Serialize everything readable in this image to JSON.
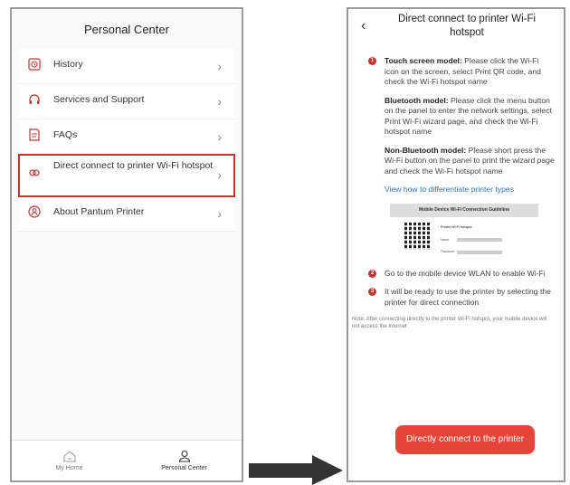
{
  "left": {
    "title": "Personal Center",
    "items": [
      {
        "label": "History",
        "icon": "history-icon"
      },
      {
        "label": "Services and Support",
        "icon": "headset-icon"
      },
      {
        "label": "FAQs",
        "icon": "faq-icon"
      },
      {
        "label": "Direct connect to printer Wi-Fi hotspot",
        "icon": "link-icon"
      },
      {
        "label": "About Pantum Printer",
        "icon": "info-icon"
      }
    ],
    "tabs": [
      "My Home",
      "Personal Center"
    ]
  },
  "right": {
    "title": "Direct connect to printer Wi-Fi hotspot",
    "step1_touch_label": "Touch screen model:",
    "step1_touch_text": " Please click the Wi-Fi icon on the screen, select Print QR code, and check the Wi-Fi hotspot name",
    "step1_bt_label": "Bluetooth model:",
    "step1_bt_text": " Please click the menu button on the panel to enter the network settings, select Print Wi-Fi wizard page, and check the Wi-Fi hotspot name",
    "step1_nbt_label": "Non-Bluetooth model:",
    "step1_nbt_text": " Please short press the Wi-Fi button on the panel to print the wizard page and check the Wi-Fi hotspot name",
    "link": "View how to differentiate printer types",
    "guide_title": "Mobile Device Wi-Fi Connection Guideline",
    "guide_hotspot": "Printer Wi-Fi hotspot",
    "guide_name": "Name",
    "guide_password": "Password",
    "step2": "Go to the mobile device WLAN to enable Wi-Fi",
    "step3": "It will be ready to use the printer by selecting the printer for direct connection",
    "note": "Note: After connecting directly to the printer Wi-Fi hotspot, your mobile device will not access the Internet",
    "button": "Directly connect to the printer"
  },
  "colors": {
    "accent": "#e64438",
    "highlight": "#c8332b",
    "link": "#2a72c8"
  }
}
